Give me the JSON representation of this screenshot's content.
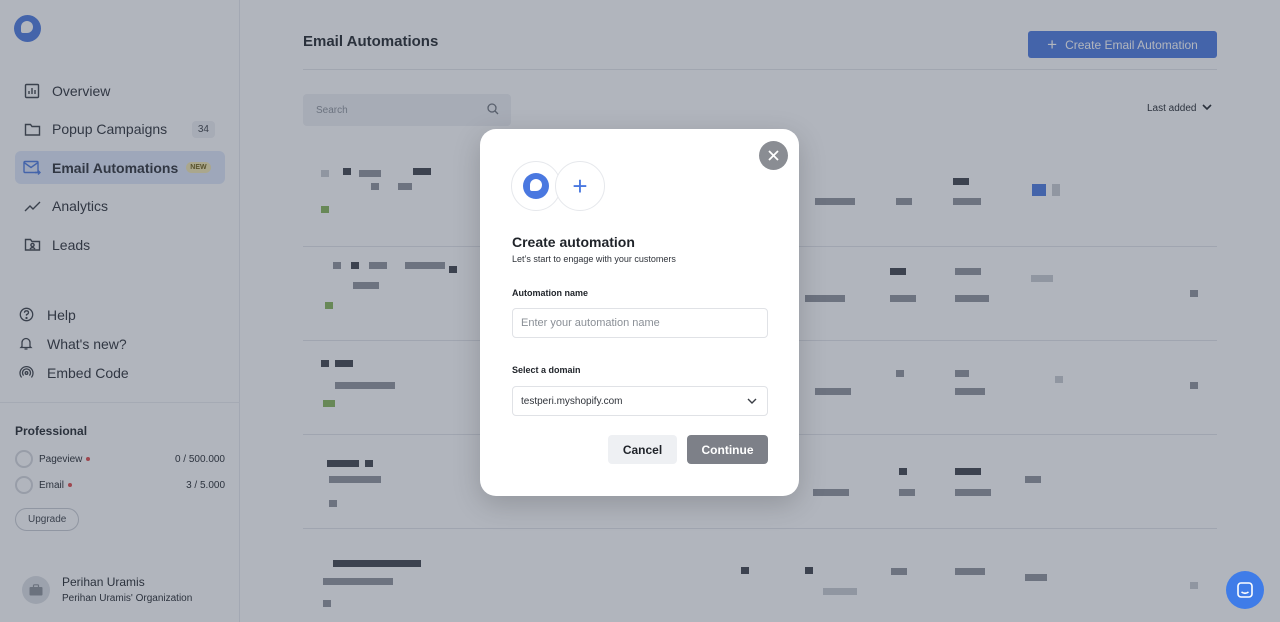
{
  "sidebar": {
    "items": [
      {
        "label": "Overview",
        "icon": "chart-icon"
      },
      {
        "label": "Popup Campaigns",
        "icon": "folder-icon",
        "count": "34"
      },
      {
        "label": "Email Automations",
        "icon": "mail-icon",
        "badge": "NEW",
        "active": true
      },
      {
        "label": "Analytics",
        "icon": "trend-icon"
      },
      {
        "label": "Leads",
        "icon": "contact-folder-icon"
      }
    ],
    "secondary": [
      {
        "label": "Help",
        "icon": "help-icon"
      },
      {
        "label": "What's new?",
        "icon": "bell-icon"
      },
      {
        "label": "Embed Code",
        "icon": "broadcast-icon"
      }
    ],
    "plan": {
      "title": "Professional",
      "usage": [
        {
          "label": "Pageview",
          "value": "0 / 500.000"
        },
        {
          "label": "Email",
          "value": "3 / 5.000"
        }
      ],
      "upgrade_label": "Upgrade"
    },
    "profile": {
      "name": "Perihan Uramis",
      "org": "Perihan Uramis' Organization"
    }
  },
  "main": {
    "title": "Email Automations",
    "create_label": "Create Email Automation",
    "search_placeholder": "Search",
    "sort_label": "Last added"
  },
  "modal": {
    "title": "Create automation",
    "subtitle": "Let’s start to engage with your customers",
    "name_label": "Automation name",
    "name_placeholder": "Enter your automation name",
    "domain_label": "Select a domain",
    "domain_value": "testperi.myshopify.com",
    "cancel_label": "Cancel",
    "continue_label": "Continue"
  },
  "colors": {
    "accent": "#4a78e0",
    "overlay": "rgba(60,70,90,0.4)",
    "continue": "#7d8088"
  }
}
